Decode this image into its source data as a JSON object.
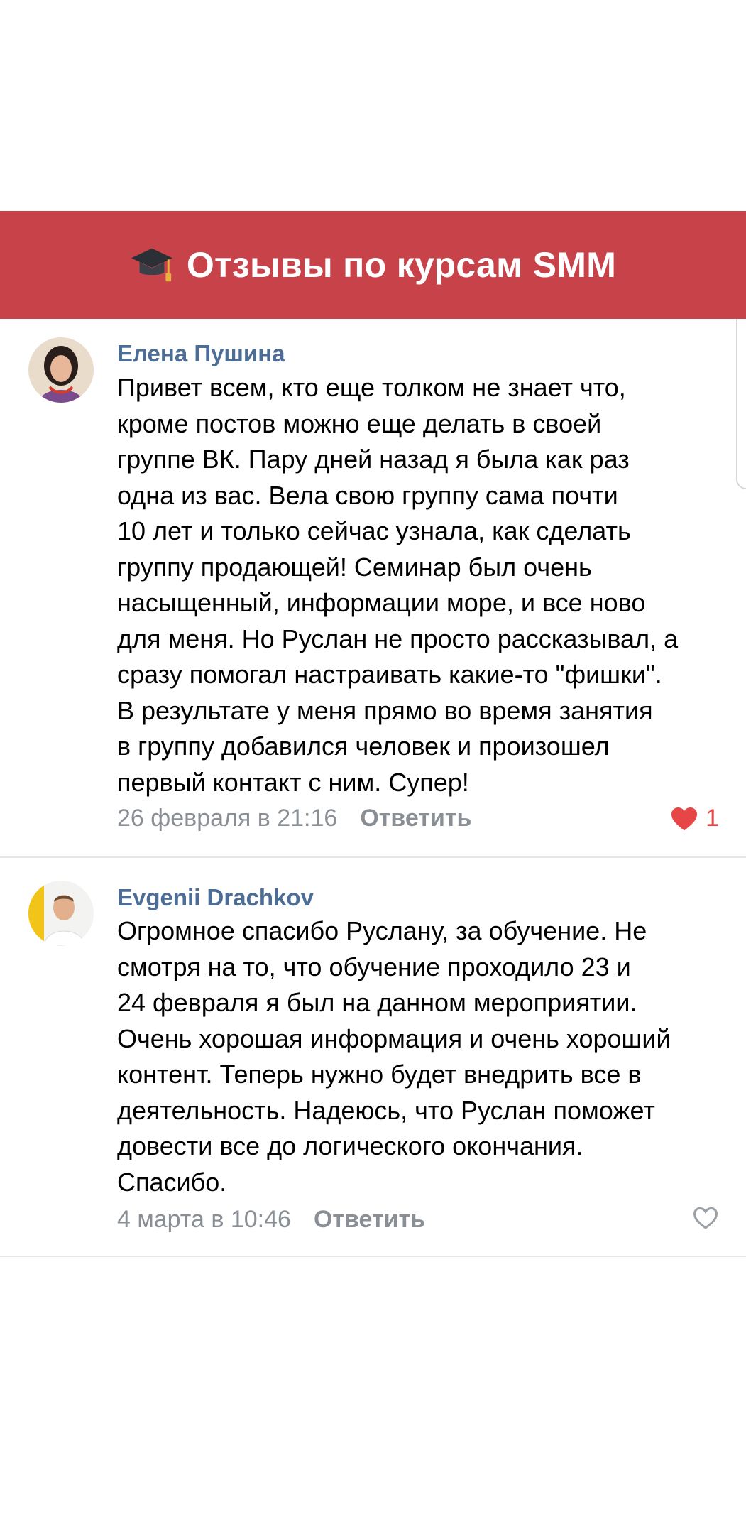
{
  "banner": {
    "icon": "graduation-cap-icon",
    "title": "Отзывы по курсам SMM"
  },
  "comments": [
    {
      "author": "Елена Пушина",
      "text": "Привет всем, кто еще толком не знает что,\nкроме постов можно еще делать в своей\nгруппе ВК. Пару дней назад я была как раз\nодна из вас. Вела свою группу сама почти\n10 лет и только сейчас узнала, как сделать\nгруппу продающей!     Семинар был очень\nнасыщенный, информации море, и все ново\nдля меня. Но Руслан не просто рассказывал, а\nсразу помогал настраивать какие-то \"фишки\".\nВ результате у меня прямо во время занятия\nв группу добавился человек и произошел\nпервый контакт с ним. Супер!",
      "date": "26 февраля в 21:16",
      "reply_label": "Ответить",
      "like_count": "1",
      "liked": true
    },
    {
      "author": "Evgenii Drachkov",
      "text": "Огромное спасибо Руслану, за обучение. Не\nсмотря на то, что обучение проходило 23 и\n24 февраля я был на данном мероприятии.\nОчень хорошая информация и очень хороший\nконтент. Теперь нужно будет внедрить все в\nдеятельность. Надеюсь, что Руслан поможет\nдовести все до логического окончания.\nСпасибо.",
      "date": "4 марта в 10:46",
      "reply_label": "Ответить",
      "liked": false
    }
  ],
  "colors": {
    "banner_bg": "#c8424a",
    "author": "#4c6d96",
    "meta": "#8a8f96",
    "like_active": "#e64646",
    "like_inactive": "#9aa0a6"
  }
}
